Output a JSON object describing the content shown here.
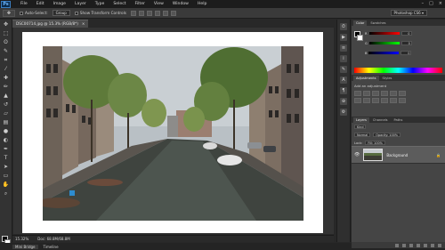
{
  "app": {
    "logo": "Ps"
  },
  "menu": [
    "File",
    "Edit",
    "Image",
    "Layer",
    "Type",
    "Select",
    "Filter",
    "View",
    "Window",
    "Help"
  ],
  "window_controls": [
    "–",
    "□",
    "×"
  ],
  "options": {
    "auto_select_label": "Auto-Select:",
    "auto_select_value": "Group",
    "show_transform_label": "Show Transform Controls",
    "workspace": "Photoshop CS6 ▾"
  },
  "document": {
    "tab_title": "DSC00714.jpg @ 15.3% (RGB/8*)",
    "close": "×"
  },
  "status": {
    "zoom": "15.32%",
    "doc_size": "Doc: 68.8M/68.8M"
  },
  "bottom_tabs": [
    "Mini Bridge",
    "Timeline"
  ],
  "panels": {
    "color_tabs": [
      "Color",
      "Swatches"
    ],
    "color_values": {
      "r": "0",
      "g": "0",
      "b": "0"
    },
    "adjust_tabs": [
      "Adjustments",
      "Styles"
    ],
    "adjust_title": "Add an adjustment",
    "layer_tabs": [
      "Layers",
      "Channels",
      "Paths"
    ],
    "layer_kind": "Kind",
    "blend_mode": "Normal",
    "opacity": "Opacity: 100%",
    "fill": "Fill: 100%",
    "lock_label": "Lock:",
    "layer_name": "Background",
    "lock_icon": "🔒"
  },
  "colors": {
    "accent": "#3a7ec2",
    "panel_bg": "#454545",
    "chrome": "#1c1c1c"
  }
}
